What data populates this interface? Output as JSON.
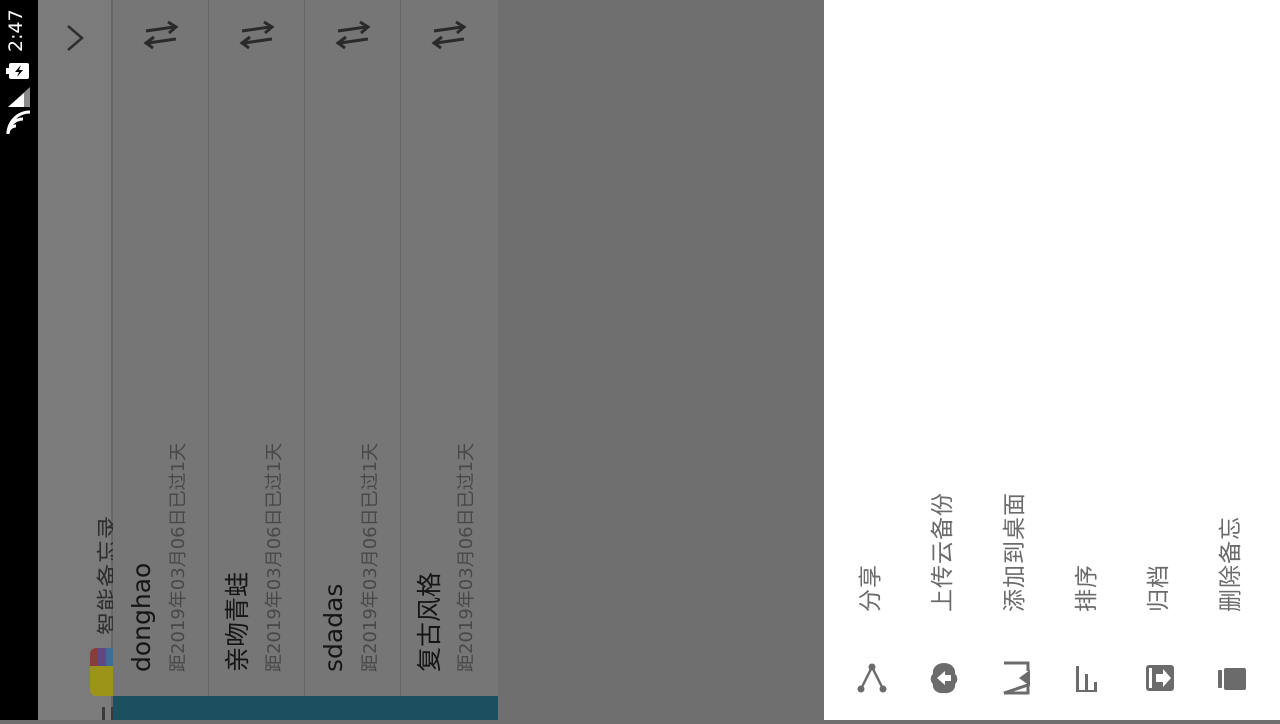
{
  "status_bar": {
    "time": "2:47"
  },
  "app": {
    "title": "智能备忘录"
  },
  "notes": [
    {
      "title": "donghao",
      "subtitle": "距2019年03月06日已过1天"
    },
    {
      "title": "亲吻青蛙",
      "subtitle": "距2019年03月06日已过1天"
    },
    {
      "title": "sdadas",
      "subtitle": "距2019年03月06日已过1天"
    },
    {
      "title": "复古风格",
      "subtitle": "距2019年03月06日已过1天"
    }
  ],
  "actions": [
    {
      "label": "分享",
      "icon": "share-icon"
    },
    {
      "label": "上传云备份",
      "icon": "cloud-upload-icon"
    },
    {
      "label": "添加到桌面",
      "icon": "add-to-desktop-icon"
    },
    {
      "label": "排序",
      "icon": "sort-icon"
    },
    {
      "label": "归档",
      "icon": "archive-icon"
    },
    {
      "label": "删除备忘",
      "icon": "delete-icon"
    }
  ],
  "colors": {
    "status_bar": "#000000",
    "overlay_gray": "#6f6f6f",
    "accent_bar": "#1c4f60",
    "panel_background": "#ffffff",
    "action_text": "#6b6b6b"
  }
}
